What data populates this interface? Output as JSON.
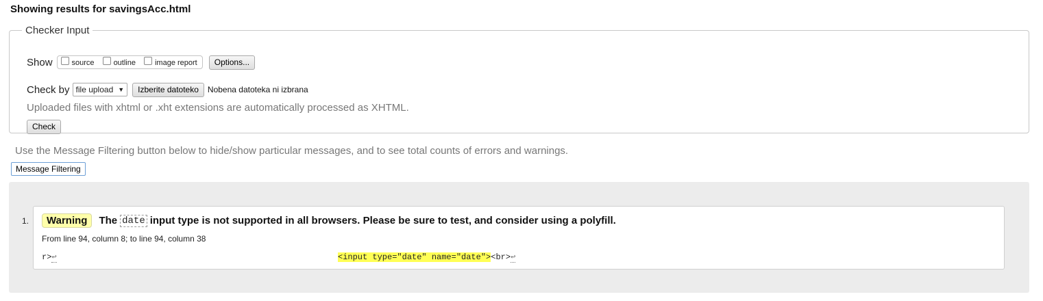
{
  "page": {
    "title": "Showing results for savingsAcc.html"
  },
  "checker_input": {
    "legend": "Checker Input",
    "show_label": "Show",
    "show_options": [
      {
        "label": "source",
        "checked": false
      },
      {
        "label": "outline",
        "checked": false
      },
      {
        "label": "image report",
        "checked": false
      }
    ],
    "options_button": "Options...",
    "check_by_label": "Check by",
    "check_by_selected": "file upload",
    "file_button": "Izberite datoteko",
    "file_status": "Nobena datoteka ni izbrana",
    "upload_note": "Uploaded files with xhtml or .xht extensions are automatically processed as XHTML.",
    "check_button": "Check"
  },
  "filtering": {
    "note": "Use the Message Filtering button below to hide/show particular messages, and to see total counts of errors and warnings.",
    "button": "Message Filtering"
  },
  "messages": [
    {
      "number": "1.",
      "type": "Warning",
      "text_before": "The",
      "code": "date",
      "text_after": "input type is not supported in all browsers. Please be sure to test, and consider using a polyfill.",
      "location": "From line 94, column 8; to line 94, column 38",
      "extract_before": "r>",
      "extract_highlight": "<input type=\"date\" name=\"date\">",
      "extract_after": "<br>",
      "return_glyph": "↩"
    }
  ],
  "colors": {
    "warning_badge": "#ffffaa",
    "extract_highlight": "#ffff55",
    "results_background": "#ececec"
  }
}
